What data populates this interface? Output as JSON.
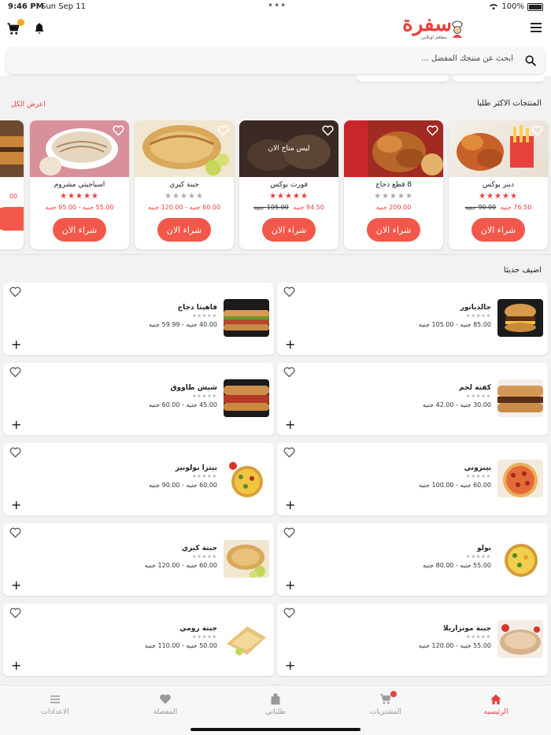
{
  "status": {
    "time": "9:46 PM",
    "date": "Sun Sep 11",
    "battery": "100%"
  },
  "header": {
    "logo_text": "سفرة",
    "logo_sub": "مطعم اونلاين",
    "brand_color": "#e8413d"
  },
  "search": {
    "placeholder": "ابحث عن منتجك المفضل ..."
  },
  "popular": {
    "title": "المنتجات الاكثر طلبا",
    "see_all": "اعرض الكل",
    "items": [
      {
        "name": "دبنر بوكس",
        "rating": 5,
        "old_price": "90.00 جنيه",
        "price": "76.50 جنيه",
        "buy": "شراء الان"
      },
      {
        "name": "8 قطع دجاج",
        "rating": 0,
        "old_price": "",
        "price": "200.00 جنيه",
        "buy": "شراء الان"
      },
      {
        "name": "فورت بوكس",
        "rating": 5,
        "old_price": "105.00 جنيه",
        "price": "94.50 جنيه",
        "buy": "شراء الان",
        "overlay": "ليس متاح الان"
      },
      {
        "name": "جبنة كيري",
        "rating": 0,
        "old_price": "",
        "price": "60.00 جنيه - 120.00 جنيه",
        "buy": "شراء الان"
      },
      {
        "name": "اسباجيتي مشروم",
        "rating": 5,
        "old_price": "",
        "price": "55.00 جنيه - 95.00 جنيه",
        "buy": "شراء الان"
      },
      {
        "name": "",
        "rating": 0,
        "old_price": "",
        "price": "00",
        "buy": ""
      }
    ]
  },
  "recent": {
    "title": "اضيف حديثا",
    "items": [
      {
        "name": "جالديانور",
        "price": "85.00 جنيه - 105.00 جنيه"
      },
      {
        "name": "فاهيتا دجاج",
        "price": "40.00 جنيه - 59.99 جنيه"
      },
      {
        "name": "كفتة لحم",
        "price": "30.00 جنيه - 42.00 جنيه"
      },
      {
        "name": "شيش طاووق",
        "price": "45.00 جنيه - 60.00 جنيه"
      },
      {
        "name": "بيبروني",
        "price": "60.00 جنيه - 100.00 جنيه"
      },
      {
        "name": "بيتزا بولونيز",
        "price": "60.00 جنيه - 90.00 جنيه"
      },
      {
        "name": "بولو",
        "price": "55.00 جنيه - 80.00 جنيه"
      },
      {
        "name": "جبنة كيري",
        "price": "60.00 جنيه - 120.00 جنيه"
      },
      {
        "name": "جبنة موتزاريلا",
        "price": "55.00 جنيه - 120.00 جنيه"
      },
      {
        "name": "جبنة رومي",
        "price": "50.00 جنيه - 110.00 جنيه"
      }
    ],
    "stars": "★★★★★"
  },
  "tabs": [
    {
      "label": "الرئيسيه",
      "icon": "home-icon"
    },
    {
      "label": "المشتريات",
      "icon": "cart-icon"
    },
    {
      "label": "طلباتي",
      "icon": "bag-icon"
    },
    {
      "label": "المفضلة",
      "icon": "heart-icon"
    },
    {
      "label": "الاعدادات",
      "icon": "settings-icon"
    }
  ]
}
